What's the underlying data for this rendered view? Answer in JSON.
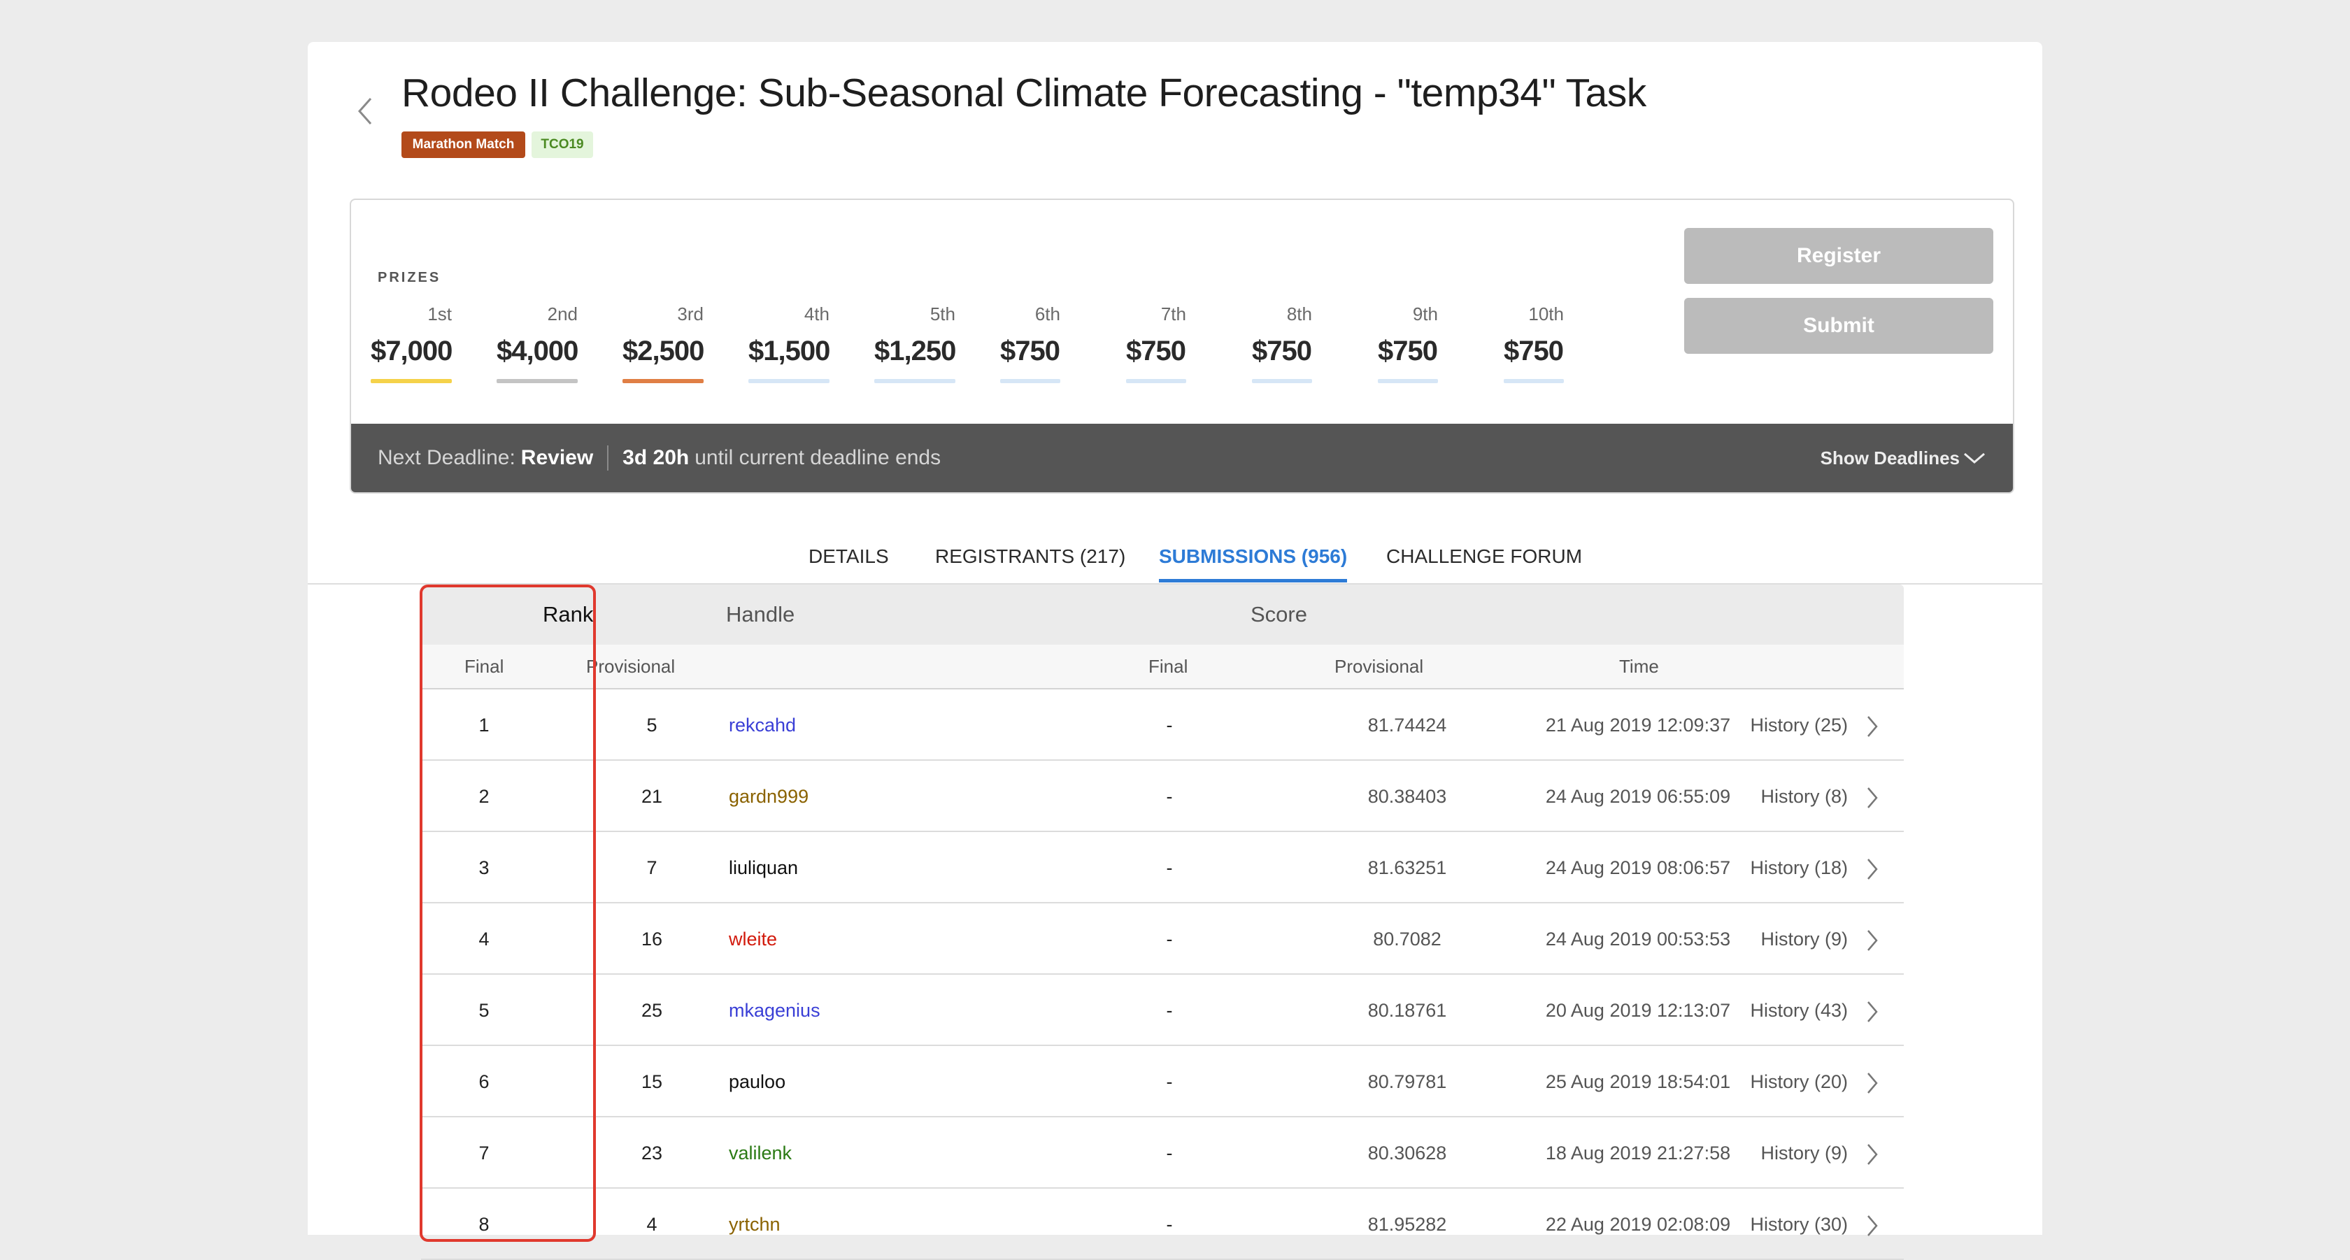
{
  "header": {
    "title": "Rodeo II Challenge: Sub-Seasonal Climate Forecasting - \"temp34\" Task",
    "tags": [
      "Marathon Match",
      "TCO19"
    ]
  },
  "prizes": {
    "label": "PRIZES",
    "items": [
      {
        "place": "1st",
        "amount": "$7,000",
        "color": "#f5d24a"
      },
      {
        "place": "2nd",
        "amount": "$4,000",
        "color": "#c4c4c4"
      },
      {
        "place": "3rd",
        "amount": "$2,500",
        "color": "#e07f45"
      },
      {
        "place": "4th",
        "amount": "$1,500",
        "color": "#d6e6f6"
      },
      {
        "place": "5th",
        "amount": "$1,250",
        "color": "#d6e6f6"
      },
      {
        "place": "6th",
        "amount": "$750",
        "color": "#d6e6f6"
      },
      {
        "place": "7th",
        "amount": "$750",
        "color": "#d6e6f6"
      },
      {
        "place": "8th",
        "amount": "$750",
        "color": "#d6e6f6"
      },
      {
        "place": "9th",
        "amount": "$750",
        "color": "#d6e6f6"
      },
      {
        "place": "10th",
        "amount": "$750",
        "color": "#d6e6f6"
      }
    ]
  },
  "actions": {
    "register": "Register",
    "submit": "Submit"
  },
  "deadline": {
    "prefix": "Next Deadline:",
    "phase": "Review",
    "remaining": "3d 20h",
    "suffix": "until current deadline ends",
    "toggle": "Show Deadlines"
  },
  "tabs": [
    {
      "label": "DETAILS",
      "active": false
    },
    {
      "label": "REGISTRANTS (217)",
      "active": false
    },
    {
      "label": "SUBMISSIONS (956)",
      "active": true
    },
    {
      "label": "CHALLENGE FORUM",
      "active": false
    }
  ],
  "table": {
    "group_headers": {
      "rank": "Rank",
      "handle": "Handle",
      "score": "Score"
    },
    "sub_headers": {
      "final": "Final",
      "provisional": "Provisional",
      "score_final": "Final",
      "score_provisional": "Provisional",
      "time": "Time"
    },
    "rows": [
      {
        "final": "1",
        "provisional": "5",
        "handle": "rekcahd",
        "handle_color": "#3a3fd6",
        "score_final": "-",
        "score_provisional": "81.74424",
        "time": "21 Aug 2019 12:09:37",
        "history": "History (25)"
      },
      {
        "final": "2",
        "provisional": "21",
        "handle": "gardn999",
        "handle_color": "#8a6200",
        "score_final": "-",
        "score_provisional": "80.38403",
        "time": "24 Aug 2019 06:55:09",
        "history": "History (8)"
      },
      {
        "final": "3",
        "provisional": "7",
        "handle": "liuliquan",
        "handle_color": "#111111",
        "score_final": "-",
        "score_provisional": "81.63251",
        "time": "24 Aug 2019 08:06:57",
        "history": "History (18)"
      },
      {
        "final": "4",
        "provisional": "16",
        "handle": "wleite",
        "handle_color": "#d21a0c",
        "score_final": "-",
        "score_provisional": "80.7082",
        "time": "24 Aug 2019 00:53:53",
        "history": "History (9)"
      },
      {
        "final": "5",
        "provisional": "25",
        "handle": "mkagenius",
        "handle_color": "#3a3fd6",
        "score_final": "-",
        "score_provisional": "80.18761",
        "time": "20 Aug 2019 12:13:07",
        "history": "History (43)"
      },
      {
        "final": "6",
        "provisional": "15",
        "handle": "pauloo",
        "handle_color": "#111111",
        "score_final": "-",
        "score_provisional": "80.79781",
        "time": "25 Aug 2019 18:54:01",
        "history": "History (20)"
      },
      {
        "final": "7",
        "provisional": "23",
        "handle": "valilenk",
        "handle_color": "#2b7a14",
        "score_final": "-",
        "score_provisional": "80.30628",
        "time": "18 Aug 2019 21:27:58",
        "history": "History (9)"
      },
      {
        "final": "8",
        "provisional": "4",
        "handle": "yrtchn",
        "handle_color": "#8a6200",
        "score_final": "-",
        "score_provisional": "81.95282",
        "time": "22 Aug 2019 02:08:09",
        "history": "History (30)"
      }
    ]
  }
}
